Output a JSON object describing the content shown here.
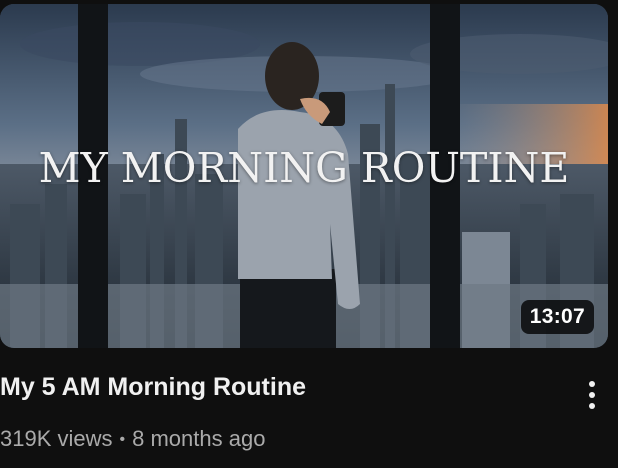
{
  "video": {
    "thumbnail_text": "MY MORNING ROUTINE",
    "duration": "13:07",
    "title": "My 5 AM Morning Routine",
    "views": "319K views",
    "separator": "•",
    "age": "8 months ago"
  },
  "icons": {
    "more": "more-vertical-icon"
  }
}
